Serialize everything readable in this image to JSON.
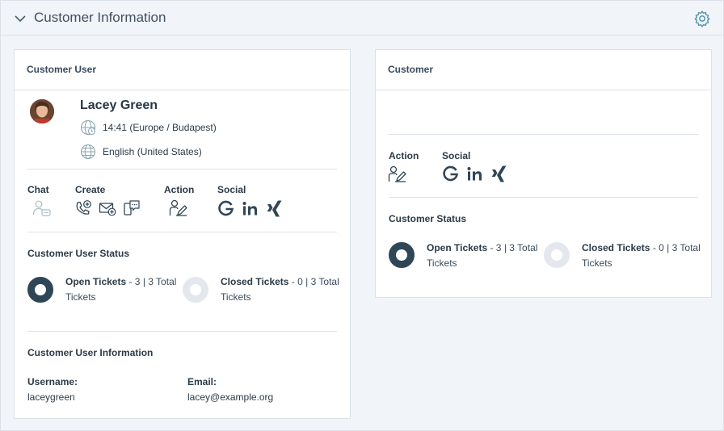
{
  "header": {
    "title": "Customer Information"
  },
  "customer_user": {
    "heading": "Customer User",
    "name": "Lacey Green",
    "time": "14:41 (Europe / Budapest)",
    "language": "English (United States)",
    "actions": {
      "chat": "Chat",
      "create": "Create",
      "action": "Action",
      "social": "Social"
    },
    "status_heading": "Customer User Status",
    "open_tickets": {
      "label": "Open Tickets",
      "detail": " - 3 | 3 Total",
      "line2": "Tickets"
    },
    "closed_tickets": {
      "label": "Closed Tickets",
      "detail": " - 0 | 3 Total",
      "line2": "Tickets"
    },
    "info_heading": "Customer User Information",
    "username_label": "Username:",
    "username_value": "laceygreen",
    "email_label": "Email:",
    "email_value": "lacey@example.org"
  },
  "customer": {
    "heading": "Customer",
    "actions": {
      "action": "Action",
      "social": "Social"
    },
    "status_heading": "Customer Status",
    "open_tickets": {
      "label": "Open Tickets",
      "detail": " - 3 | 3 Total",
      "line2": "Tickets"
    },
    "closed_tickets": {
      "label": "Closed Tickets",
      "detail": " - 0 | 3 Total",
      "line2": "Tickets"
    }
  },
  "icons": {
    "collapse": "chevron-down-icon",
    "settings": "gear-icon",
    "timezone": "globe-clock-icon",
    "language": "globe-icon",
    "chat": "user-chat-icon",
    "call": "phone-add-icon",
    "email": "mail-add-icon",
    "sms": "sms-add-icon",
    "action": "user-edit-icon",
    "google": "google-icon",
    "linkedin": "linkedin-icon",
    "xing": "xing-icon"
  },
  "colors": {
    "accent": "#4a90a8",
    "dark": "#2f4656",
    "ring_light": "#e4e8ee",
    "icon_muted": "#8aa6b4"
  }
}
